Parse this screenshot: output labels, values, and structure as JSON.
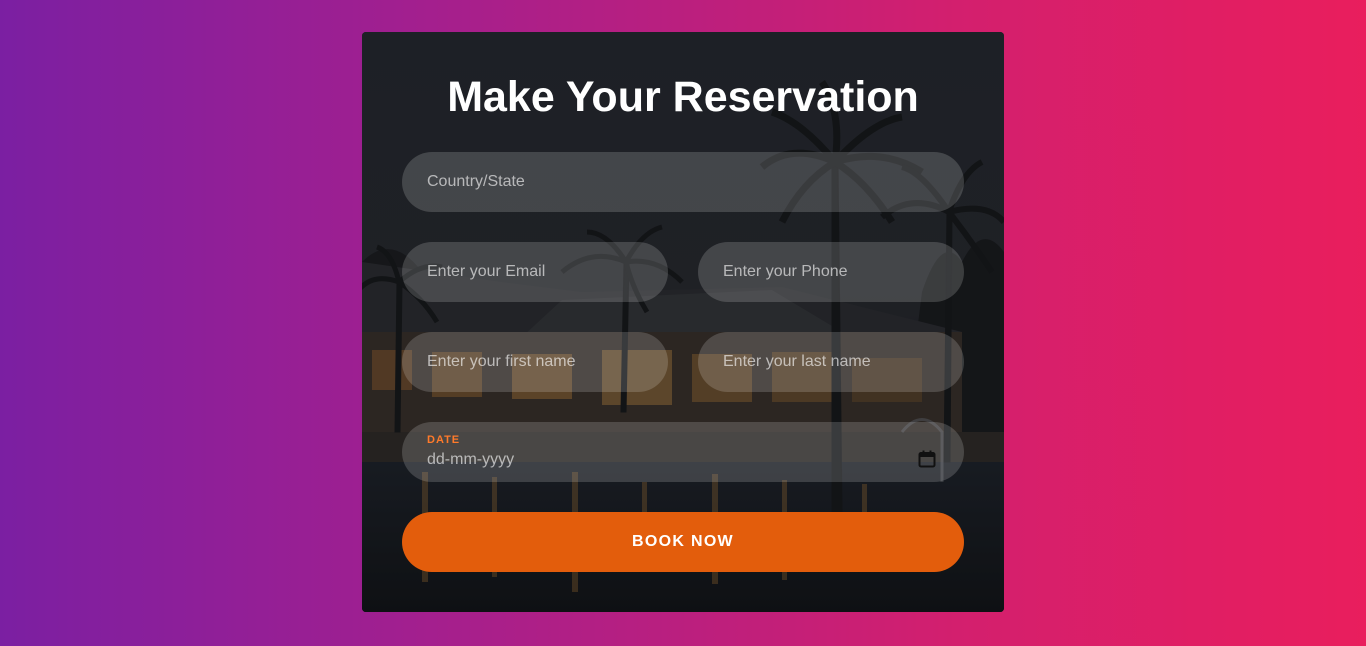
{
  "form": {
    "title": "Make Your Reservation",
    "country_placeholder": "Country/State",
    "email_placeholder": "Enter your Email",
    "phone_placeholder": "Enter your Phone",
    "first_name_placeholder": "Enter your first name",
    "last_name_placeholder": "Enter your last name",
    "date_label": "DATE",
    "date_placeholder": "dd-mm-yyyy",
    "submit_label": "BOOK NOW"
  },
  "icons": {
    "date_picker": "calendar-icon"
  },
  "colors": {
    "accent": "#e35d0c",
    "date_label": "#ff7a2a",
    "background_start": "#7b1fa2",
    "background_end": "#e91e5d"
  }
}
